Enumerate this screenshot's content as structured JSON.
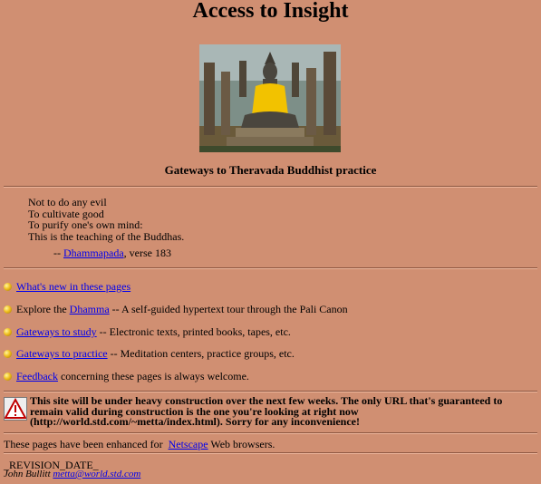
{
  "header": {
    "title": "Access to Insight"
  },
  "image": {
    "icon": "buddha-statue-photo",
    "accent": "#f2c200"
  },
  "subtitle": "Gateways to Theravada Buddhist practice",
  "verse": {
    "lines": [
      "Not to do any evil",
      "To cultivate good",
      "To purify one's own mind:",
      "This is the teaching of the Buddhas."
    ],
    "cite_prefix": "-- ",
    "cite_link": "Dhammapada",
    "cite_suffix": ", verse 183"
  },
  "menu": {
    "whats_new": "What's new in these pages",
    "explore_prefix": "Explore the ",
    "explore_link": "Dhamma",
    "explore_suffix": " -- A self-guided hypertext tour through the Pali Canon",
    "study_link": "Gateways to study",
    "study_suffix": " -- Electronic texts, printed books, tapes, etc.",
    "practice_link": "Gateways to practice",
    "practice_suffix": " -- Meditation centers, practice groups, etc.",
    "feedback_link": "Feedback",
    "feedback_suffix": " concerning these pages is always welcome."
  },
  "notice": {
    "icon": "warning-icon",
    "text": "This site will be under heavy construction over the next few weeks. The only URL that's guaranteed to remain valid during construction is the one you're looking at right now (http://world.std.com/~metta/index.html). Sorry for any inconvenience!"
  },
  "footer": {
    "enhanced_prefix": "These pages have been enhanced for ",
    "enhanced_link": "Netscape",
    "enhanced_suffix": " Web browsers.",
    "revision": "_REVISION_DATE_",
    "author": "John Bullitt",
    "email": "metta@world.std.com"
  },
  "colors": {
    "background": "#d08f72",
    "link": "#0000ee"
  }
}
